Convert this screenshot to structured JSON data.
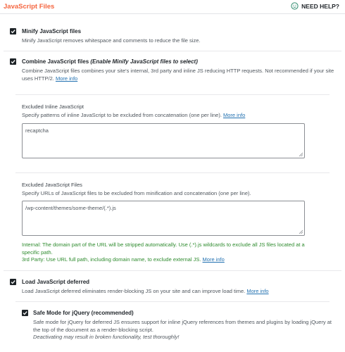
{
  "header": {
    "title": "JavaScript Files",
    "help_label": "NEED HELP?"
  },
  "minify": {
    "label": "Minify JavaScript files",
    "description": "Minify JavaScript removes whitespace and comments to reduce the file size.",
    "checked": true
  },
  "combine": {
    "label": "Combine JavaScript files",
    "label_hint": "(Enable Minify JavaScript files to select)",
    "description_line1": "Combine JavaScript files combines your site's internal, 3rd party and inline JS reducing HTTP requests. Not recommended if your site",
    "description_line2": "uses HTTP/2.",
    "more_info": "More info",
    "checked": true
  },
  "excluded_inline": {
    "label": "Excluded Inline JavaScript",
    "description": "Specify patterns of inline JavaScript to be excluded from concatenation (one per line).",
    "more_info": "More info",
    "value": "recaptcha"
  },
  "excluded_files": {
    "label": "Excluded JavaScript Files",
    "description": "Specify URLs of JavaScript files to be excluded from minification and concatenation (one per line).",
    "value": "/wp-content/themes/some-theme/(.*).js",
    "internal_label": "Internal:",
    "internal_text_line1": " The domain part of the URL will be stripped automatically. Use (.*).js wildcards to exclude all JS files located at a",
    "internal_text_line2": "specific path.",
    "third_party_label": "3rd Party:",
    "third_party_text": " Use URL full path, including domain name, to exclude external JS.",
    "more_info": "More info"
  },
  "defer": {
    "label": "Load JavaScript deferred",
    "description": "Load JavaScript deferred eliminates render-blocking JS on your site and can improve load time.",
    "more_info": "More info",
    "checked": true
  },
  "safe_mode": {
    "label": "Safe Mode for jQuery (recommended)",
    "description_line1": "Safe mode for jQuery for deferred JS ensures support for inline jQuery references from themes and plugins by loading jQuery at",
    "description_line2": "the top of the document as a render-blocking script.",
    "warning": "Deactivating may result in broken functionality, test thoroughly!",
    "checked": true
  },
  "icons": {
    "checkbox": "checkmark-icon",
    "help": "help-smiley-icon",
    "resize": "resize-handle-icon"
  },
  "colors": {
    "accent": "#f56640",
    "link": "#2271b1",
    "green": "#2e8b2e",
    "checkbox": "#1d2327"
  }
}
